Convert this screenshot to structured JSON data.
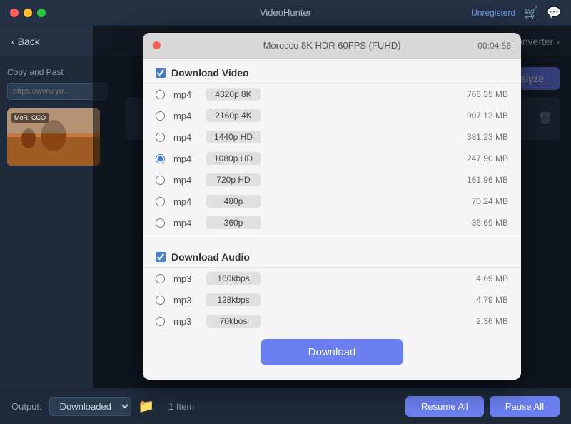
{
  "titleBar": {
    "title": "VideoHunter",
    "unregistered": "Unregisterd",
    "icons": [
      "cart-icon",
      "chat-icon"
    ]
  },
  "navBar": {
    "back": "Back",
    "converter": "Converter"
  },
  "sidebar": {
    "sectionTitle": "Copy and Past",
    "urlPlaceholder": "https://www.yo...",
    "thumbnailLabel": "MoR. CCO"
  },
  "analyzeButton": "Analyze",
  "dialog": {
    "titleText": "Morocco 8K HDR 60FPS (FUHD)",
    "duration": "00:04:56",
    "videoSection": {
      "title": "Download Video",
      "rows": [
        {
          "type": "mp4",
          "quality": "4320p 8K",
          "size": "766.35 MB"
        },
        {
          "type": "mp4",
          "quality": "2160p 4K",
          "size": "907.12 MB"
        },
        {
          "type": "mp4",
          "quality": "1440p HD",
          "size": "381.23 MB"
        },
        {
          "type": "mp4",
          "quality": "1080p HD",
          "size": "247.90 MB"
        },
        {
          "type": "mp4",
          "quality": "720p HD",
          "size": "161.96 MB"
        },
        {
          "type": "mp4",
          "quality": "480p",
          "size": "70.24 MB"
        },
        {
          "type": "mp4",
          "quality": "360p",
          "size": "36.69 MB"
        }
      ]
    },
    "audioSection": {
      "title": "Download Audio",
      "rows": [
        {
          "type": "mp3",
          "quality": "160kbps",
          "size": "4.69 MB"
        },
        {
          "type": "mp3",
          "quality": "128kbps",
          "size": "4.79 MB"
        },
        {
          "type": "mp3",
          "quality": "70kbos",
          "size": "2.36 MB"
        }
      ]
    },
    "downloadButton": "Download"
  },
  "bottomBar": {
    "outputLabel": "Output:",
    "outputValue": "Downloaded",
    "itemCount": "1 Item",
    "resumeAll": "Resume All",
    "pauseAll": "Pause All"
  }
}
